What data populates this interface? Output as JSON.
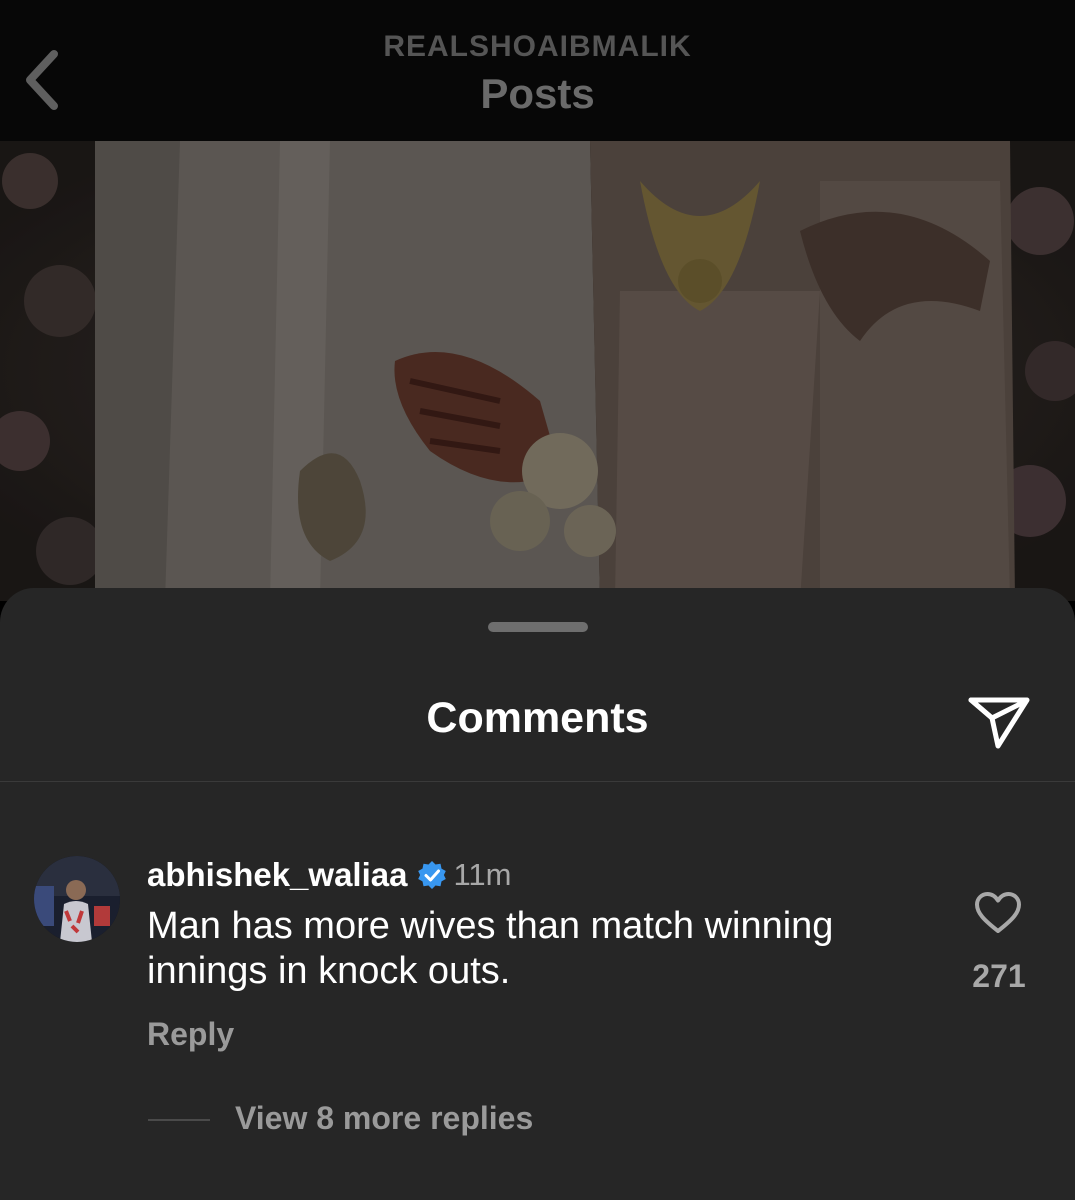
{
  "header": {
    "back_icon": "chevron-left-icon",
    "username": "REALSHOAIBMALIK",
    "title": "Posts"
  },
  "post": {
    "photo_description_icon": "wedding-photo"
  },
  "comments_sheet": {
    "title": "Comments",
    "share_icon": "paper-plane-icon",
    "comment": {
      "username": "abhishek_waliaa",
      "verified_icon": "verified-badge-icon",
      "timestamp": "11m",
      "text": "Man has more wives than match winning innings in knock outs.",
      "reply_label": "Reply",
      "like_icon": "heart-outline-icon",
      "like_count": "271",
      "view_replies_label": "View 8 more replies"
    }
  },
  "colors": {
    "header_bg": "#070707",
    "sheet_bg": "#262626",
    "primary_text": "#ffffff",
    "secondary_text": "#a8a8a8",
    "verified_blue": "#3897f0"
  }
}
